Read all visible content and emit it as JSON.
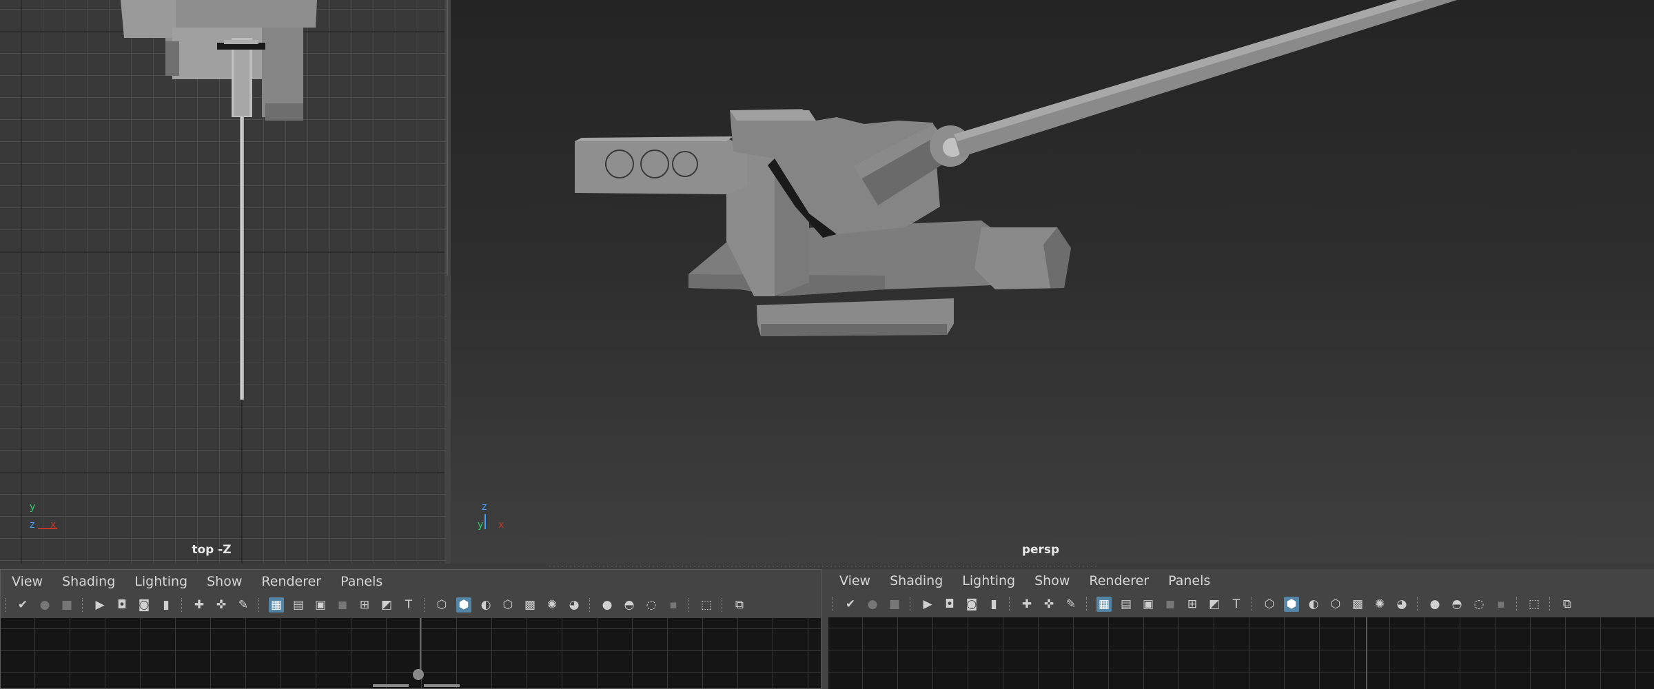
{
  "viewports": {
    "top": {
      "camera_label": "top -Z",
      "axis_labels": [
        "y",
        "z",
        "x"
      ]
    },
    "persp": {
      "camera_label": "persp",
      "axis_labels": [
        "z",
        "y",
        "x"
      ]
    }
  },
  "panels": [
    {
      "menu": [
        "View",
        "Shading",
        "Lighting",
        "Show",
        "Renderer",
        "Panels"
      ]
    },
    {
      "menu": [
        "View",
        "Shading",
        "Lighting",
        "Show",
        "Renderer",
        "Panels"
      ]
    }
  ],
  "toolbar_icons": [
    "select-camera-icon",
    "camera-attributes-icon",
    "bookmarks-icon",
    "image-plane-icon",
    "2d-pan-zoom-icon",
    "grease-pencil-icon",
    "grid-icon",
    "film-gate-icon",
    "resolution-gate-icon",
    "gate-mask-icon",
    "field-chart-icon",
    "safe-action-icon",
    "safe-title-icon",
    "wireframe-icon",
    "smooth-shade-icon",
    "default-lighting-icon",
    "textured-icon",
    "shadows-icon",
    "screen-space-ao-icon",
    "motion-blur-icon",
    "isolate-select-icon",
    "xray-icon",
    "xray-joints-icon",
    "camera-select-icon"
  ],
  "colors": {
    "accent": "#5285a6",
    "axis_x": "#c0392b",
    "axis_y": "#2ecc71",
    "axis_z": "#3ea0ff"
  }
}
